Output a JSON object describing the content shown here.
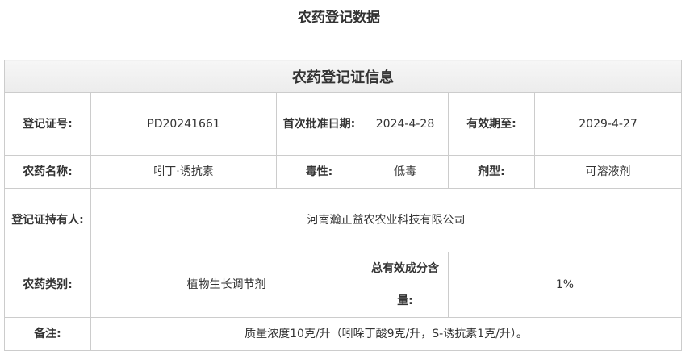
{
  "page": {
    "title": "农药登记数据"
  },
  "registration": {
    "caption": "农药登记证信息",
    "cert_no_label": "登记证号:",
    "cert_no": "PD20241661",
    "first_approval_label": "首次批准日期:",
    "first_approval_date": "2024-4-28",
    "valid_until_label": "有效期至:",
    "valid_until": "2029-4-27",
    "name_label": "农药名称:",
    "name": "吲丁·诱抗素",
    "toxicity_label": "毒性:",
    "toxicity": "低毒",
    "formulation_label": "剂型:",
    "formulation": "可溶液剂",
    "holder_label": "登记证持有人:",
    "holder": "河南瀚正益农农业科技有限公司",
    "category_label": "农药类别:",
    "category": "植物生长调节剂",
    "total_content_label": "总有效成分含量:",
    "total_content": "1%",
    "remark_label": "备注:",
    "remark": "质量浓度10克/升（吲哚丁酸9克/升，S-诱抗素1克/升）。"
  }
}
